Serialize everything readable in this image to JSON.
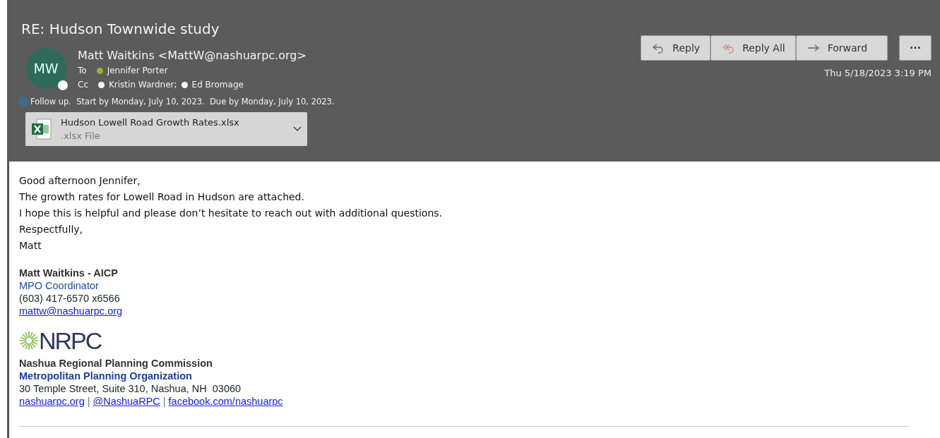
{
  "subject": "RE: Hudson Townwide study",
  "sender": {
    "initials": "MW",
    "name": "Matt Waitkins <MattW@nashuarpc.org>"
  },
  "to": {
    "label": "To",
    "recipients": [
      {
        "name": "Jennifer Porter",
        "color": "#8fb82a"
      }
    ]
  },
  "cc": {
    "label": "Cc",
    "recipients": [
      {
        "name": "Kristin Wardner;",
        "color": "#ffffff"
      },
      {
        "name": "Ed Bromage",
        "color": "#ffffff"
      }
    ]
  },
  "follow_up": "Follow up.  Start by Monday, July 10, 2023.  Due by Monday, July 10, 2023.",
  "attachment": {
    "name": "Hudson Lowell Road Growth Rates.xlsx",
    "type": ".xlsx File"
  },
  "actions": [
    {
      "kind": "reply",
      "label": "Reply"
    },
    {
      "kind": "reply-all",
      "label": "Reply All"
    },
    {
      "kind": "forward",
      "label": "Forward"
    },
    {
      "kind": "more",
      "label": "···"
    }
  ],
  "date": "Thu 5/18/2023 3:19 PM",
  "body": [
    "Good afternoon Jennifer,",
    "The growth rates for Lowell Road in Hudson are attached.",
    "I hope this is helpful and please don’t hesitate to reach out with additional questions.",
    "Respectfully,",
    "Matt"
  ],
  "signature": {
    "name": "Matt Waitkins - AICP",
    "title": "MPO Coordinator",
    "phone": "(603) 417-6570 x6566",
    "email": "mattw@nashuarpc.org",
    "logo": "NRPC",
    "org": "Nashua Regional Planning Commission",
    "org2": "Metropolitan Planning Organization",
    "address": "30 Temple Street, Suite 310, Nashua, NH  03060",
    "links": [
      {
        "text": "nashuarpc.org"
      },
      {
        "text": "|",
        "kind": "sep"
      },
      {
        "text": "@NashuaRPC"
      },
      {
        "text": "|",
        "kind": "sep"
      },
      {
        "text": "facebook.com/nashuarpc"
      }
    ]
  }
}
